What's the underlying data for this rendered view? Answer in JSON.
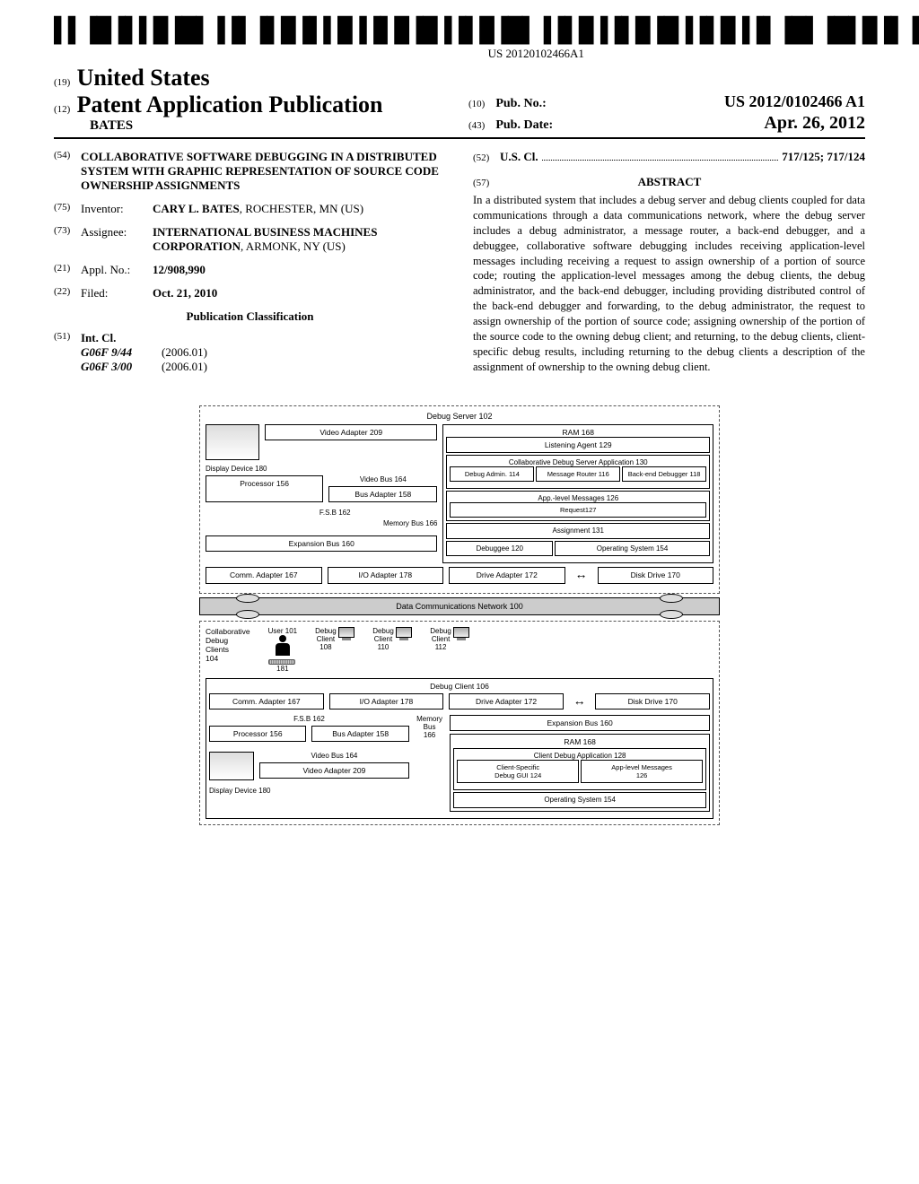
{
  "barcode_text": "US 20120102466A1",
  "header": {
    "num19": "(19)",
    "country": "United States",
    "num12": "(12)",
    "pub_type": "Patent Application Publication",
    "author": "BATES",
    "num10": "(10)",
    "pub_no_lbl": "Pub. No.:",
    "pub_no": "US 2012/0102466 A1",
    "num43": "(43)",
    "pub_date_lbl": "Pub. Date:",
    "pub_date": "Apr. 26, 2012"
  },
  "fields": {
    "num54": "(54)",
    "title": "COLLABORATIVE SOFTWARE DEBUGGING IN A DISTRIBUTED SYSTEM WITH GRAPHIC REPRESENTATION OF SOURCE CODE OWNERSHIP ASSIGNMENTS",
    "num75": "(75)",
    "inventor_lbl": "Inventor:",
    "inventor_name": "CARY L. BATES",
    "inventor_loc": ", ROCHESTER, MN (US)",
    "num73": "(73)",
    "assignee_lbl": "Assignee:",
    "assignee_name": "INTERNATIONAL BUSINESS MACHINES CORPORATION",
    "assignee_loc": ", ARMONK, NY (US)",
    "num21": "(21)",
    "appl_lbl": "Appl. No.:",
    "appl_no": "12/908,990",
    "num22": "(22)",
    "filed_lbl": "Filed:",
    "filed_date": "Oct. 21, 2010",
    "pub_class": "Publication Classification",
    "num51": "(51)",
    "int_cl_lbl": "Int. Cl.",
    "int_cl_1_code": "G06F 9/44",
    "int_cl_1_ver": "(2006.01)",
    "int_cl_2_code": "G06F 3/00",
    "int_cl_2_ver": "(2006.01)",
    "num52": "(52)",
    "us_cl_lbl": "U.S. Cl.",
    "us_cl_val": "717/125; 717/124",
    "num57": "(57)",
    "abstract_lbl": "ABSTRACT",
    "abstract": "In a distributed system that includes a debug server and debug clients coupled for data communications through a data communications network, where the debug server includes a debug administrator, a message router, a back-end debugger, and a debuggee, collaborative software debugging includes receiving application-level messages including receiving a request to assign ownership of a portion of source code; routing the application-level messages among the debug clients, the debug administrator, and the back-end debugger, including providing distributed control of the back-end debugger and forwarding, to the debug administrator, the request to assign ownership of the portion of source code; assigning ownership of the portion of the source code to the owning debug client; and returning, to the debug clients, client-specific debug results, including returning to the debug clients a description of the assignment of ownership to the owning debug client."
  },
  "figure": {
    "debug_server": "Debug Server 102",
    "video_adapter": "Video Adapter\n209",
    "display_device": "Display Device 180",
    "video_bus": "Video Bus\n164",
    "processor": "Processor\n156",
    "fsb": "F.S.B\n162",
    "bus_adapter": "Bus Adapter\n158",
    "memory_bus": "Memory Bus\n166",
    "ram": "RAM 168",
    "listening": "Listening Agent 129",
    "collab_app": "Collaborative Debug Server Application 130",
    "debug_admin": "Debug Admin.\n114",
    "msg_router": "Message\nRouter 116",
    "backend": "Back-end\nDebugger 118",
    "app_msgs": "App.-level Messages 126",
    "request": "Request127",
    "assignment": "Assignment 131",
    "debuggee": "Debuggee 120",
    "os": "Operating System 154",
    "expansion": "Expansion Bus 160",
    "comm_adapter": "Comm. Adapter\n167",
    "io_adapter": "I/O Adapter\n178",
    "drive_adapter": "Drive Adapter\n172",
    "disk_drive": "Disk Drive\n170",
    "network": "Data Communications Network 100",
    "collab_clients": "Collaborative\nDebug\nClients\n104",
    "user": "User 101",
    "dc108": "Debug\nClient\n108",
    "dc110": "Debug\nClient\n110",
    "dc112": "Debug\nClient\n112",
    "n181": "181",
    "debug_client": "Debug Client 106",
    "client_app": "Client Debug Application 128",
    "client_gui": "Client-Specific\nDebug GUI 124",
    "client_msgs": "App-level Messages\n126"
  }
}
